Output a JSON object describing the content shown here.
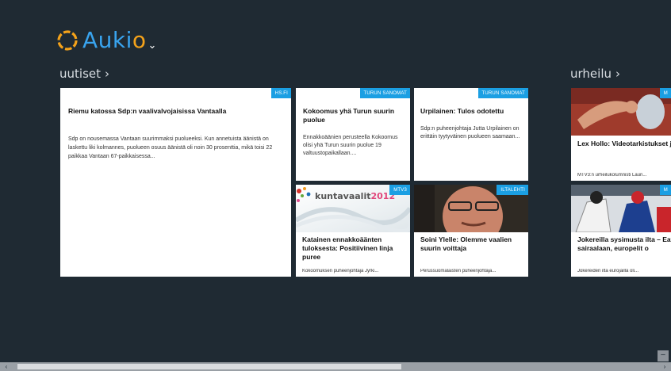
{
  "app": {
    "logo_text_prefix": "Auki",
    "logo_text_o": "o",
    "brand_blue": "#39a4ef",
    "brand_orange": "#f4a21a",
    "menu_caret": "⌄"
  },
  "sections": [
    {
      "label": "uutiset",
      "chevron": "›"
    },
    {
      "label": "urheilu",
      "chevron": "›"
    }
  ],
  "tiles": {
    "big": {
      "source": "HS.FI",
      "title": "Riemu katossa Sdp:n vaalivalvojaisissa Vantaalla",
      "body": "Sdp on nousemassa Vantaan suurimmaksi puolueeksi. Kun annetuista äänistä on laskettu liki kolmannes, puolueen osuus äänistä oli noin 30 prosenttia, mikä toisi 22 paikkaa Vantaan 67-paikkaisessa..."
    },
    "kokoomus": {
      "source": "TURUN SANOMAT",
      "title": "Kokoomus yhä Turun suurin puolue",
      "body": "Ennakkoäänien perusteella Kokoomus olisi yhä Turun suurin puolue 19 valtuustopaikallaan...."
    },
    "urpilainen": {
      "source": "TURUN SANOMAT",
      "title": "Urpilainen: Tulos odotettu",
      "body": "Sdp:n puheenjohtaja Jutta Urpilainen on erittäin tyytyväinen puolueen saamaan..."
    },
    "katainen": {
      "source": "MTV3",
      "image_text_prefix": "kuntavaalit",
      "image_text_year": "2012",
      "title": "Katainen ennakkoäänten tuloksesta: Positiivinen linja puree",
      "foot": "Kokoomuksen puheenjohtaja Jyrki..."
    },
    "soini": {
      "source": "ILTALEHTI",
      "title": "Soini Ylelle: Olemme vaalien suurin voittaja",
      "foot": "Perussuomalaisten puheenjohtaja..."
    },
    "hollo": {
      "source": "M",
      "title": "Lex Hollo: Videotarkistukset jalkapalloon",
      "foot": "MTV3:n urheilukolumnisti Lauri..."
    },
    "jokerit": {
      "source": "M",
      "title": "Jokereilla sysimusta ilta – Eaves sairaalaan, europelit o",
      "foot": "Jokereiden ilta eurojäillä oli..."
    }
  },
  "scrollbar": {
    "left_arrow": "‹",
    "right_arrow": "›",
    "zoom_button": "−",
    "position": 0.58
  }
}
